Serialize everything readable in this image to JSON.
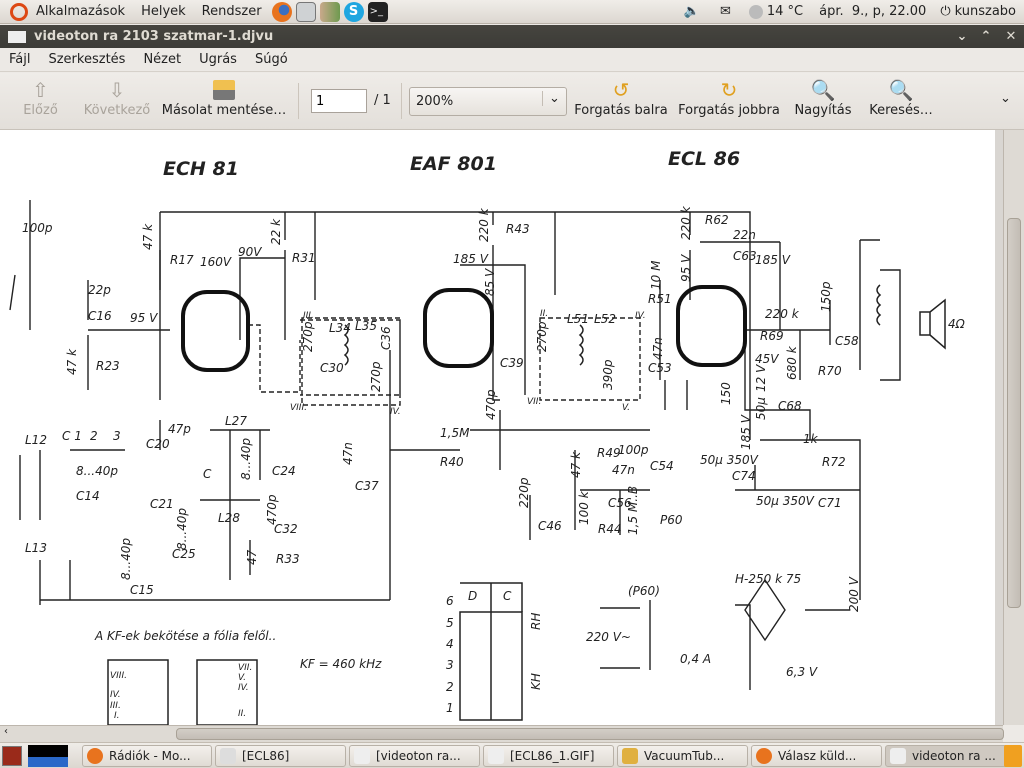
{
  "top_panel": {
    "menus": [
      "Alkalmazások",
      "Helyek",
      "Rendszer"
    ],
    "launchers": [
      "firefox-icon",
      "disk-utility-icon",
      "users-icon",
      "skype-icon",
      "terminal-icon"
    ],
    "weather": "14 °C",
    "clock": "ápr.  9., p, 22.00",
    "user": "kunszabo"
  },
  "window": {
    "title": "videoton ra 2103 szatmar-1.djvu"
  },
  "menu": [
    "Fájl",
    "Szerkesztés",
    "Nézet",
    "Ugrás",
    "Súgó"
  ],
  "toolbar": {
    "prev": "Előző",
    "next": "Következő",
    "save_copy": "Másolat mentése…",
    "page_value": "1",
    "page_total": "/ 1",
    "zoom": "200%",
    "rotate_left": "Forgatás balra",
    "rotate_right": "Forgatás jobbra",
    "zoom_in": "Nagyítás",
    "find": "Keresés…"
  },
  "schematic": {
    "tubes": [
      "ECH 81",
      "EAF 801",
      "ECL 86"
    ],
    "labels": [
      "100p",
      "22p",
      "C16",
      "95 V",
      "47 k",
      "R17",
      "160V",
      "90V",
      "22 k",
      "R31",
      "47 k",
      "R23",
      "220 k",
      "R43",
      "185 V",
      "85 V",
      "220 k",
      "R62",
      "22n",
      "C63",
      "185 V",
      "10 M",
      "95 V",
      "R51",
      "220 k",
      "R69",
      "150p",
      "C58",
      "4Ω",
      "47n",
      "C53",
      "45V",
      "12 V",
      "680 k",
      "R70",
      "150",
      "50µ",
      "C68",
      "185 V",
      "1k",
      "R72",
      "50µ 350V",
      "C74",
      "50µ 350V",
      "C71",
      "1,5M",
      "R40",
      "47n",
      "C37",
      "47 k",
      "R49",
      "100p",
      "C54",
      "47n",
      "220p",
      "C46",
      "100 k",
      "R44",
      "C56",
      "1,5 M..B",
      "P60",
      "270p",
      "C30",
      "L34",
      "L35",
      "C36",
      "270p",
      "270p",
      "L51",
      "L52",
      "390p",
      "C39",
      "470p",
      "L12",
      "C 1",
      "2",
      "3",
      "8...40p",
      "C14",
      "L13",
      "8...40p",
      "C15",
      "C20",
      "47p",
      "L27",
      "8...40p",
      "C24",
      "C21",
      "C",
      "470p",
      "C32",
      "L28",
      "8...40p",
      "C25",
      "47",
      "R33",
      "III.",
      "VIII.",
      "IV.",
      "II.",
      "VII.",
      "IV.",
      "V."
    ],
    "note": "A KF-ek bekötése a fólia felől..",
    "kf": "KF = 460 kHz",
    "switch_header": [
      "D",
      "C"
    ],
    "switch_rows": [
      "6",
      "5",
      "4",
      "3",
      "2",
      "1"
    ],
    "switch_labels": [
      "RH",
      "KH"
    ],
    "power": {
      "p60": "(P60)",
      "transformer": "H-250 k 75",
      "mains": "220 V~",
      "fuse": "0,4 A",
      "heater": "6,3 V",
      "hv": "200 V"
    },
    "foil": {
      "left": [
        "VIII.",
        "IV.",
        "III.",
        "I."
      ],
      "right": [
        "VII.",
        "V.",
        "IV.",
        "II."
      ]
    }
  },
  "taskbar": [
    "Rádiók - Mo...",
    "[ECL86]",
    "[videoton ra...",
    "[ECL86_1.GIF]",
    "VacuumTub...",
    "Válasz küld...",
    "videoton ra ..."
  ]
}
